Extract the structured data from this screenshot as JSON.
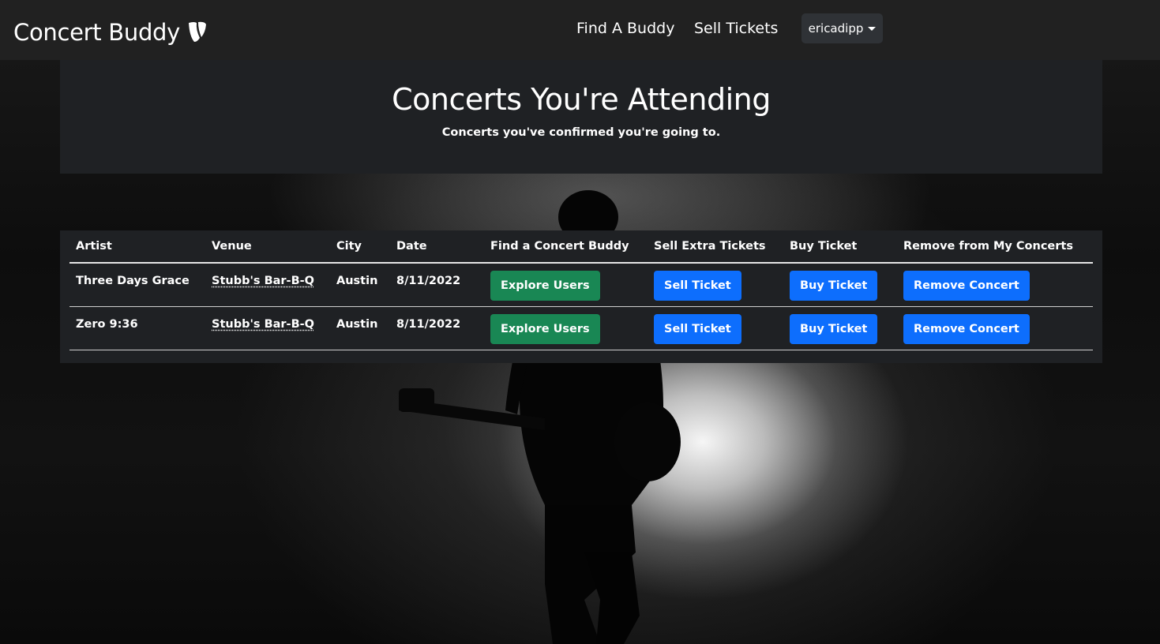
{
  "navbar": {
    "brand": "Concert Buddy",
    "brand_icon": "typo3-logo-icon",
    "links": [
      {
        "label": "Find A Buddy"
      },
      {
        "label": "Sell Tickets"
      }
    ],
    "user": {
      "label": "ericadipp",
      "icon": "caret-down-icon"
    }
  },
  "header": {
    "title": "Concerts You're Attending",
    "subtitle": "Concerts you've confirmed you're going to."
  },
  "table": {
    "columns": [
      "Artist",
      "Venue",
      "City",
      "Date",
      "Find a Concert Buddy",
      "Sell Extra Tickets",
      "Buy Ticket",
      "Remove from My Concerts"
    ],
    "rows": [
      {
        "artist": "Three Days Grace",
        "venue": "Stubb's Bar-B-Q",
        "city": "Austin",
        "date": "8/11/2022",
        "explore_label": "Explore Users",
        "sell_label": "Sell Ticket",
        "buy_label": "Buy Ticket",
        "remove_label": "Remove Concert"
      },
      {
        "artist": "Zero 9:36",
        "venue": "Stubb's Bar-B-Q",
        "city": "Austin",
        "date": "8/11/2022",
        "explore_label": "Explore Users",
        "sell_label": "Sell Ticket",
        "buy_label": "Buy Ticket",
        "remove_label": "Remove Concert"
      }
    ]
  },
  "colors": {
    "navbar_bg": "#212121",
    "panel_bg": "#1f2124",
    "success": "#198754",
    "primary": "#0d6efd"
  }
}
